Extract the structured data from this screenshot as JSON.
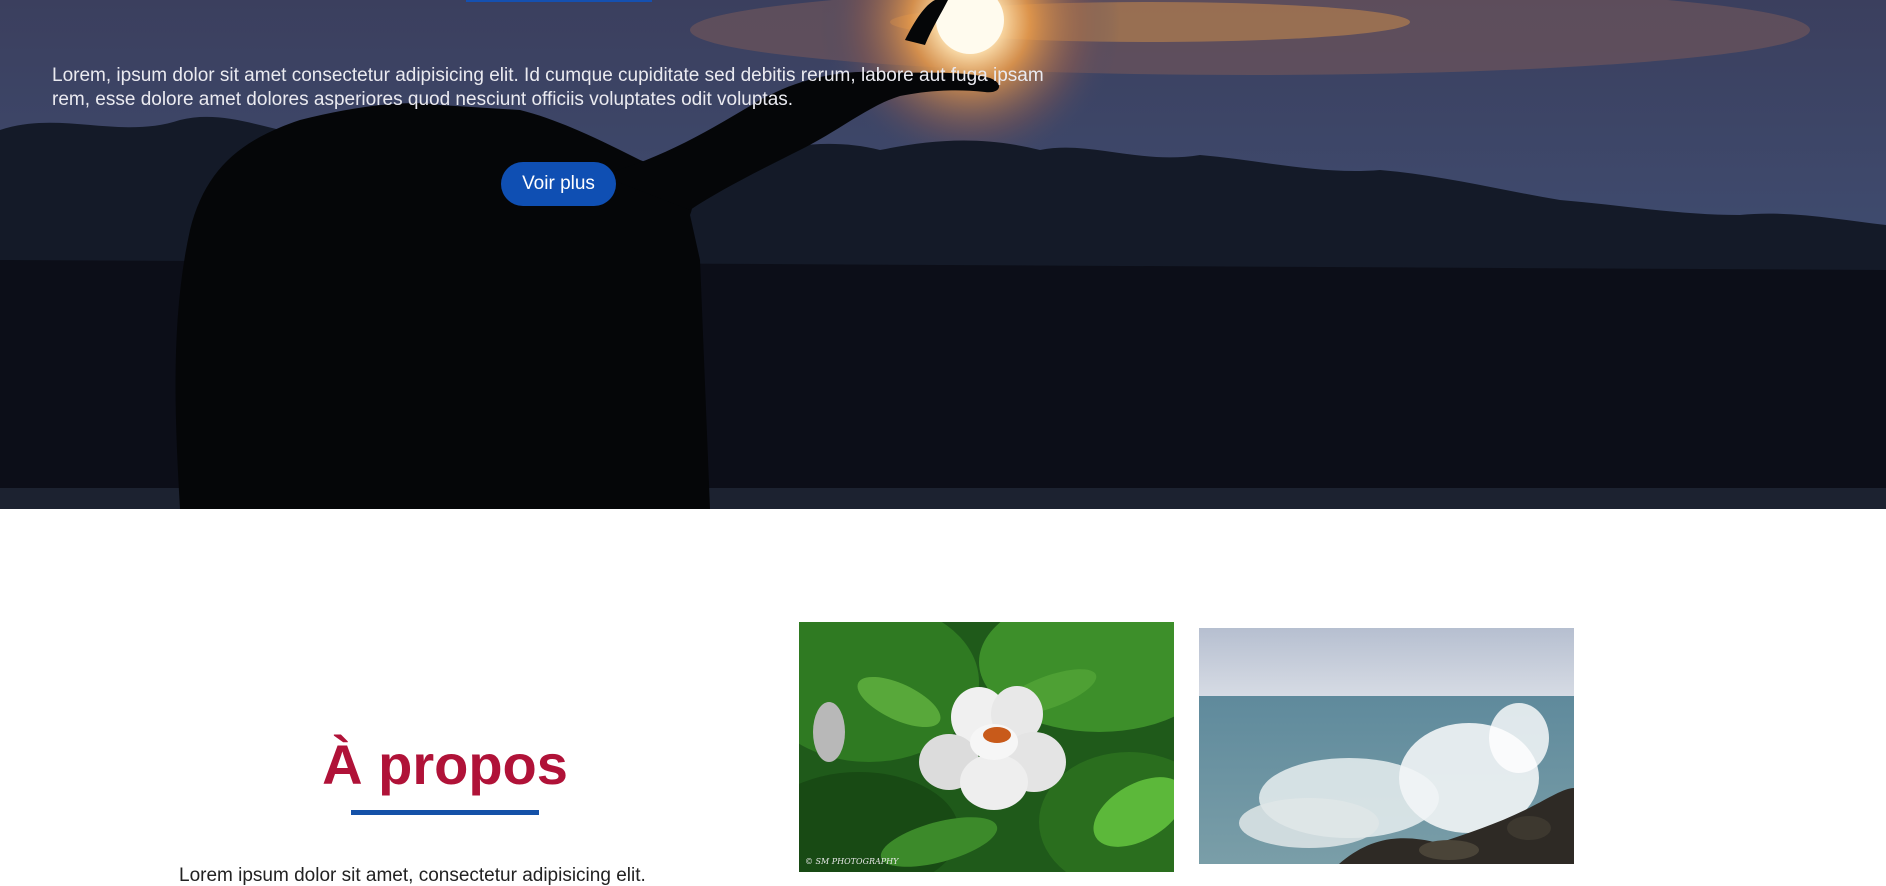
{
  "hero": {
    "description": "Lorem, ipsum dolor sit amet consectetur adipisicing elit. Id cumque cupiditate sed debitis rerum, labore aut fuga ipsam rem, esse dolore amet dolores asperiores quod nesciunt officiis voluptates odit voluptas.",
    "button_label": "Voir plus"
  },
  "about": {
    "title": "À propos",
    "text": "Lorem ipsum dolor sit amet, consectetur adipisicing elit."
  },
  "photos": [
    {
      "watermark": "© SM PHOTOGRAPHY"
    }
  ],
  "colors": {
    "accent_blue": "#0f4fb3",
    "title_red": "#b01238"
  }
}
